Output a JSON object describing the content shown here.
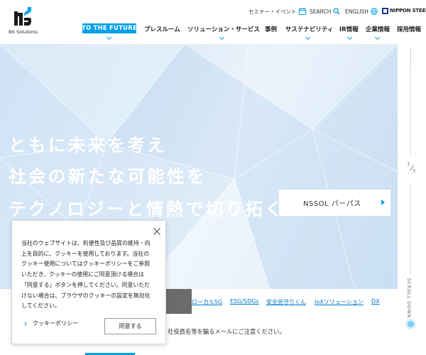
{
  "brand": {
    "logo_text": "NS Solutions",
    "group_logo": "NIPPON STEEL"
  },
  "utility": {
    "seminar": "セミナー・イベント",
    "search": "SEARCH",
    "english": "ENGLISH"
  },
  "nav": {
    "future": "TO THE FUTURE",
    "items": [
      "プレスルーム",
      "ソリューション・サービス",
      "事例",
      "サステナビリティ",
      "IR情報",
      "企業情報",
      "採用情報"
    ]
  },
  "hero": {
    "lines": [
      "ともに未来を考え",
      "社会の新たな可能性を",
      "テクノロジーと情熱で切り拓く"
    ],
    "purpose_button": "NSSOL パーパス",
    "slide_current": "1",
    "slide_total": "5",
    "scroll_label": "SCROLL DOWN"
  },
  "tags": [
    "ローカル5G",
    "ESG/SDGs",
    "安全見守りくん",
    "IoXソリューション",
    "DX"
  ],
  "notice": "社役員名等を騙るメールにご注意ください。",
  "cookie": {
    "lines": [
      "当社のウェブサイトは、利便性及び品質の維持・向",
      "上を目的に、クッキーを使用しております。当社の",
      "クッキー使用についてはクッキーポリシーをご参照",
      "いただき、クッキーの使用にご同意頂ける場合は",
      "「同意する」ボタンを押してください。同意いただ",
      "けない場合は、ブラウザのクッキーの設定を無効化",
      "してください。"
    ],
    "policy_link": "クッキーポリシー",
    "agree_button": "同意する"
  },
  "colors": {
    "accent": "#00a0e9",
    "link": "#0077c8"
  }
}
